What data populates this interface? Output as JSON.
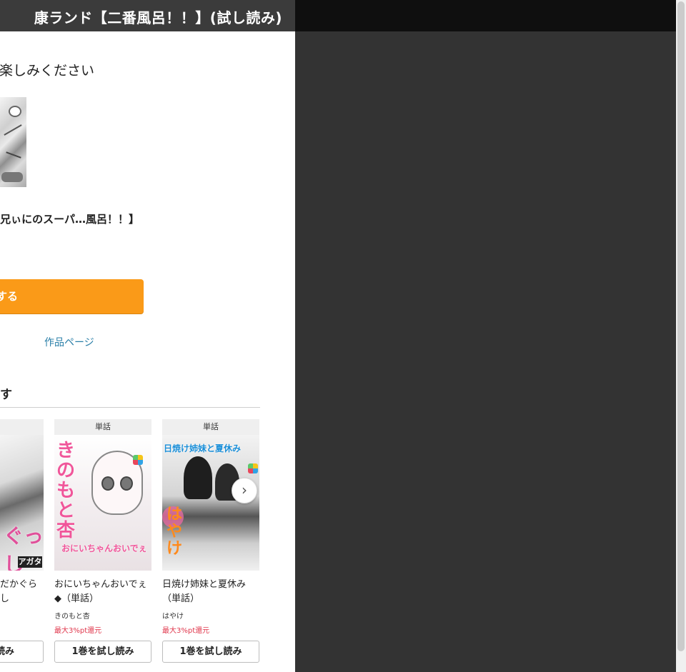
{
  "header": {
    "title": "康ランド【二番風呂！！】(試し読み)"
  },
  "main": {
    "heading": "楽しみください",
    "subtitle": "兄ぃにのスーパ…風呂！！】",
    "cta_label": "する",
    "work_page_link": "作品ページ",
    "recommend_title": "す"
  },
  "cards": [
    {
      "badge": "話",
      "title": "だかぐらし",
      "author": "",
      "points": "",
      "button": "読み",
      "cover_caption": "アガタ"
    },
    {
      "badge": "単話",
      "title": "おにいちゃんおいでぇ◆（単話）",
      "author": "きのもと杏",
      "points": "最大3%pt還元",
      "button": "1巻を試し読み",
      "cover_title": "きのもと杏",
      "cover_caption": "おにいちゃんおいでぇ"
    },
    {
      "badge": "単話",
      "title": "日焼け姉妹と夏休み（単話）",
      "author": "はやけ",
      "points": "最大3%pt還元",
      "button": "1巻を試し読み",
      "cover_title": "日焼け姉妹と夏休み",
      "cover_caption": "はやけ"
    }
  ],
  "carousel": {
    "next_icon": "chevron-right-icon"
  },
  "colors": {
    "accent_orange": "#fa9a18",
    "link_blue": "#2a7fa8",
    "point_red": "#e0384d",
    "dark_bg": "#333333"
  }
}
